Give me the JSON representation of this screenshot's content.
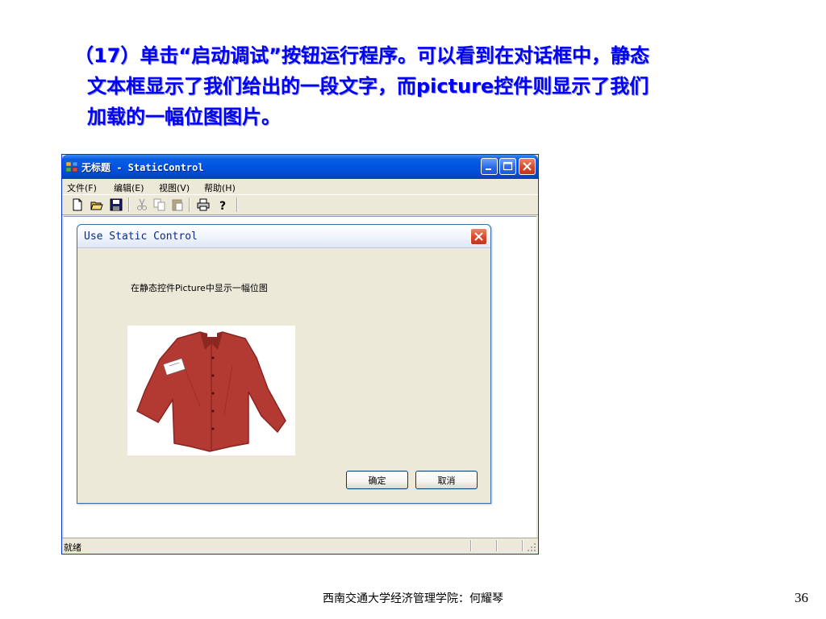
{
  "slide": {
    "lines": [
      "（17）单击“启动调试”按钮运行程序。可以看到在对话框中，静态",
      "文本框显示了我们给出的一段文字，而picture控件则显示了我们",
      "加载的一幅位图图片。"
    ],
    "footer": "西南交通大学经济管理学院：何耀琴",
    "page_number": "36"
  },
  "window": {
    "title": "无标题 - StaticControl",
    "menus": [
      "文件(F)",
      "编辑(E)",
      "视图(V)",
      "帮助(H)"
    ],
    "toolbar_icons": [
      "new-icon",
      "open-icon",
      "save-icon",
      "cut-icon",
      "copy-icon",
      "paste-icon",
      "print-icon",
      "help-icon"
    ],
    "status": "就绪"
  },
  "dialog": {
    "title": "Use Static Control",
    "static_text": "在静态控件Picture中显示一幅位图",
    "picture": "red-shirt-bitmap",
    "ok_label": "确定",
    "cancel_label": "取消"
  },
  "colors": {
    "slide_text": "#0000ff",
    "xp_titlebar": "#0054e3",
    "window_face": "#ece9d8",
    "shirt": "#b33a33"
  }
}
